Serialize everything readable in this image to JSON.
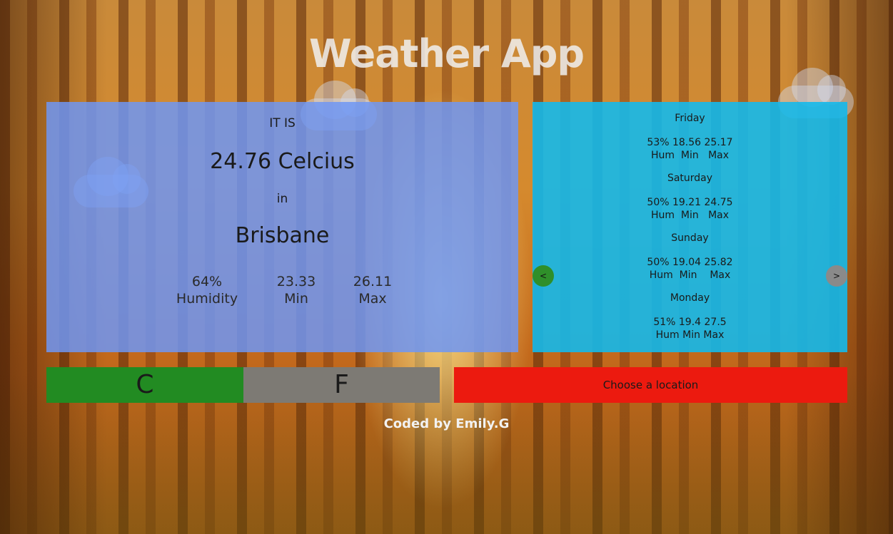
{
  "app": {
    "title": "Weather App"
  },
  "current": {
    "label_it_is": "IT IS",
    "temperature": "24.76 Celcius",
    "label_in": "in",
    "city": "Brisbane",
    "stats": [
      {
        "value": "64%",
        "label": "Humidity"
      },
      {
        "value": "23.33",
        "label": "Min"
      },
      {
        "value": "26.11",
        "label": "Max"
      }
    ]
  },
  "forecast": {
    "prev_label": "<",
    "next_label": ">",
    "days": [
      {
        "day": "Friday",
        "values": "53% 18.56 25.17",
        "labels": "Hum  Min   Max"
      },
      {
        "day": "Saturday",
        "values": "50% 19.21 24.75",
        "labels": "Hum  Min   Max"
      },
      {
        "day": "Sunday",
        "values": "50% 19.04 25.82",
        "labels": "Hum  Min    Max"
      },
      {
        "day": "Monday",
        "values": "51%  19.4 27.5",
        "labels": "Hum Min Max"
      }
    ]
  },
  "units": {
    "celsius_label": "C",
    "fahrenheit_label": "F"
  },
  "location": {
    "button_label": "Choose a location"
  },
  "footer": {
    "credit": "Coded by Emily.G"
  },
  "colors": {
    "current_panel": "#6e96f5",
    "forecast_panel": "#14b9eb",
    "celsius_button": "#228b22",
    "fahrenheit_button": "#7d7a74",
    "location_button": "#ec1a0f"
  }
}
